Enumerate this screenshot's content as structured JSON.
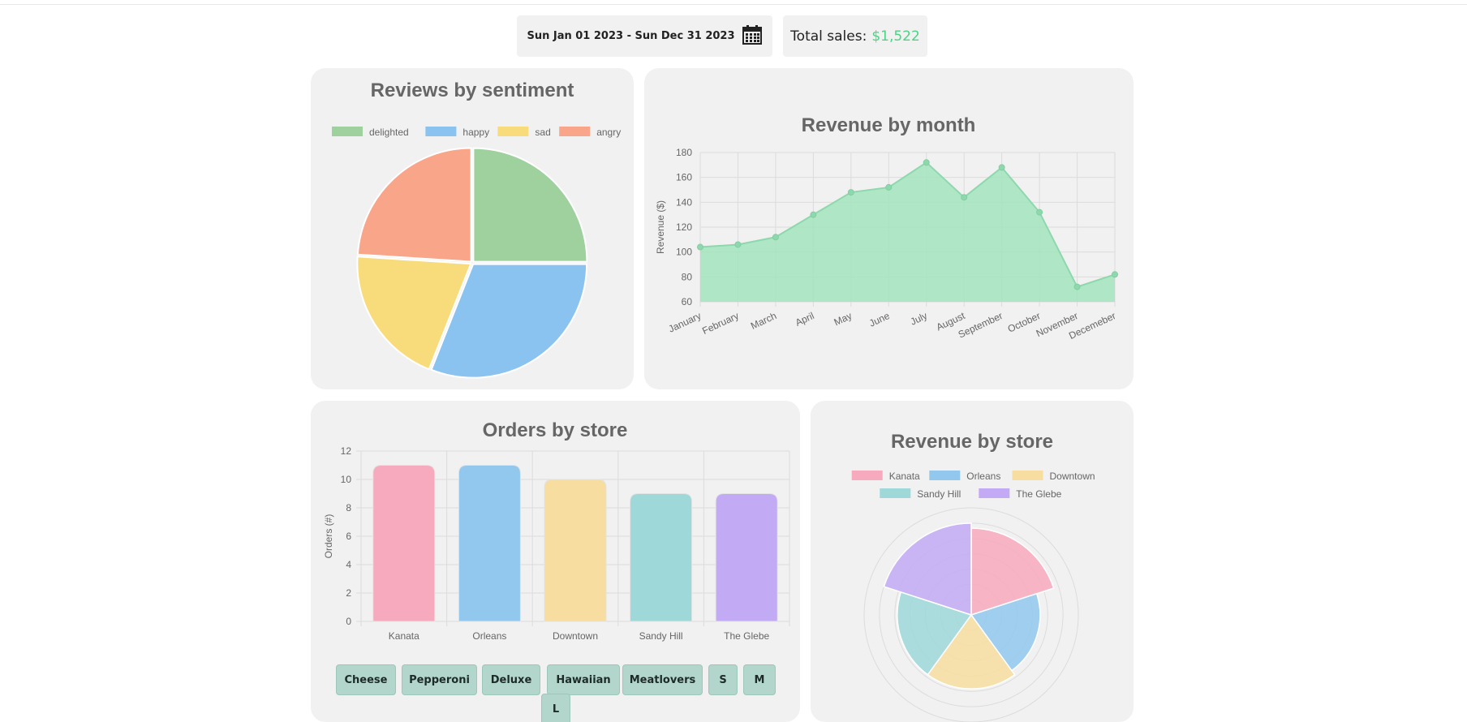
{
  "header": {
    "date_range": "Sun Jan 01 2023 - Sun Dec 31 2023",
    "total_label": "Total sales:",
    "total_value": "$1,522"
  },
  "filters": {
    "items": [
      "Cheese",
      "Pepperoni",
      "Deluxe",
      "Hawaiian",
      "Meatlovers",
      "S",
      "M",
      "L"
    ]
  },
  "colors": {
    "accent_green": "#4cd384",
    "pink": "#f7a9bd",
    "blue": "#92c8ee",
    "yellow": "#f7dea0",
    "teal": "#9ed8d9",
    "purple": "#c3aaf5",
    "pie_green": "#9fd19f",
    "pie_blue": "#8ac2f0",
    "pie_yellow": "#f8dc7c",
    "pie_red": "#f8a58a"
  },
  "chart_data": [
    {
      "type": "pie",
      "title": "Reviews by sentiment",
      "legend_position": "top",
      "categories": [
        "delighted",
        "happy",
        "sad",
        "angry"
      ],
      "values": [
        25,
        31,
        20,
        24
      ]
    },
    {
      "type": "area",
      "title": "Revenue by month",
      "ylabel": "Revenue ($)",
      "categories": [
        "January",
        "February",
        "March",
        "April",
        "May",
        "June",
        "July",
        "August",
        "September",
        "October",
        "November",
        "Decemeber"
      ],
      "values": [
        104,
        106,
        112,
        130,
        148,
        152,
        172,
        144,
        168,
        132,
        72,
        82
      ],
      "ylim": [
        60,
        180
      ],
      "yticks": [
        60,
        80,
        100,
        120,
        140,
        160,
        180
      ],
      "grid": true
    },
    {
      "type": "bar",
      "title": "Orders by store",
      "ylabel": "Orders (#)",
      "categories": [
        "Kanata",
        "Orleans",
        "Downtown",
        "Sandy Hill",
        "The Glebe"
      ],
      "values": [
        11,
        11,
        10,
        9,
        9
      ],
      "ylim": [
        0,
        12
      ],
      "yticks": [
        0,
        2,
        4,
        6,
        8,
        10,
        12
      ],
      "grid": true
    },
    {
      "type": "polarArea",
      "title": "Revenue by store",
      "legend_position": "top",
      "categories": [
        "Kanata",
        "Orleans",
        "Downtown",
        "Sandy Hill",
        "The Glebe"
      ],
      "values": [
        340,
        270,
        290,
        290,
        360
      ],
      "rmax": 420
    }
  ]
}
